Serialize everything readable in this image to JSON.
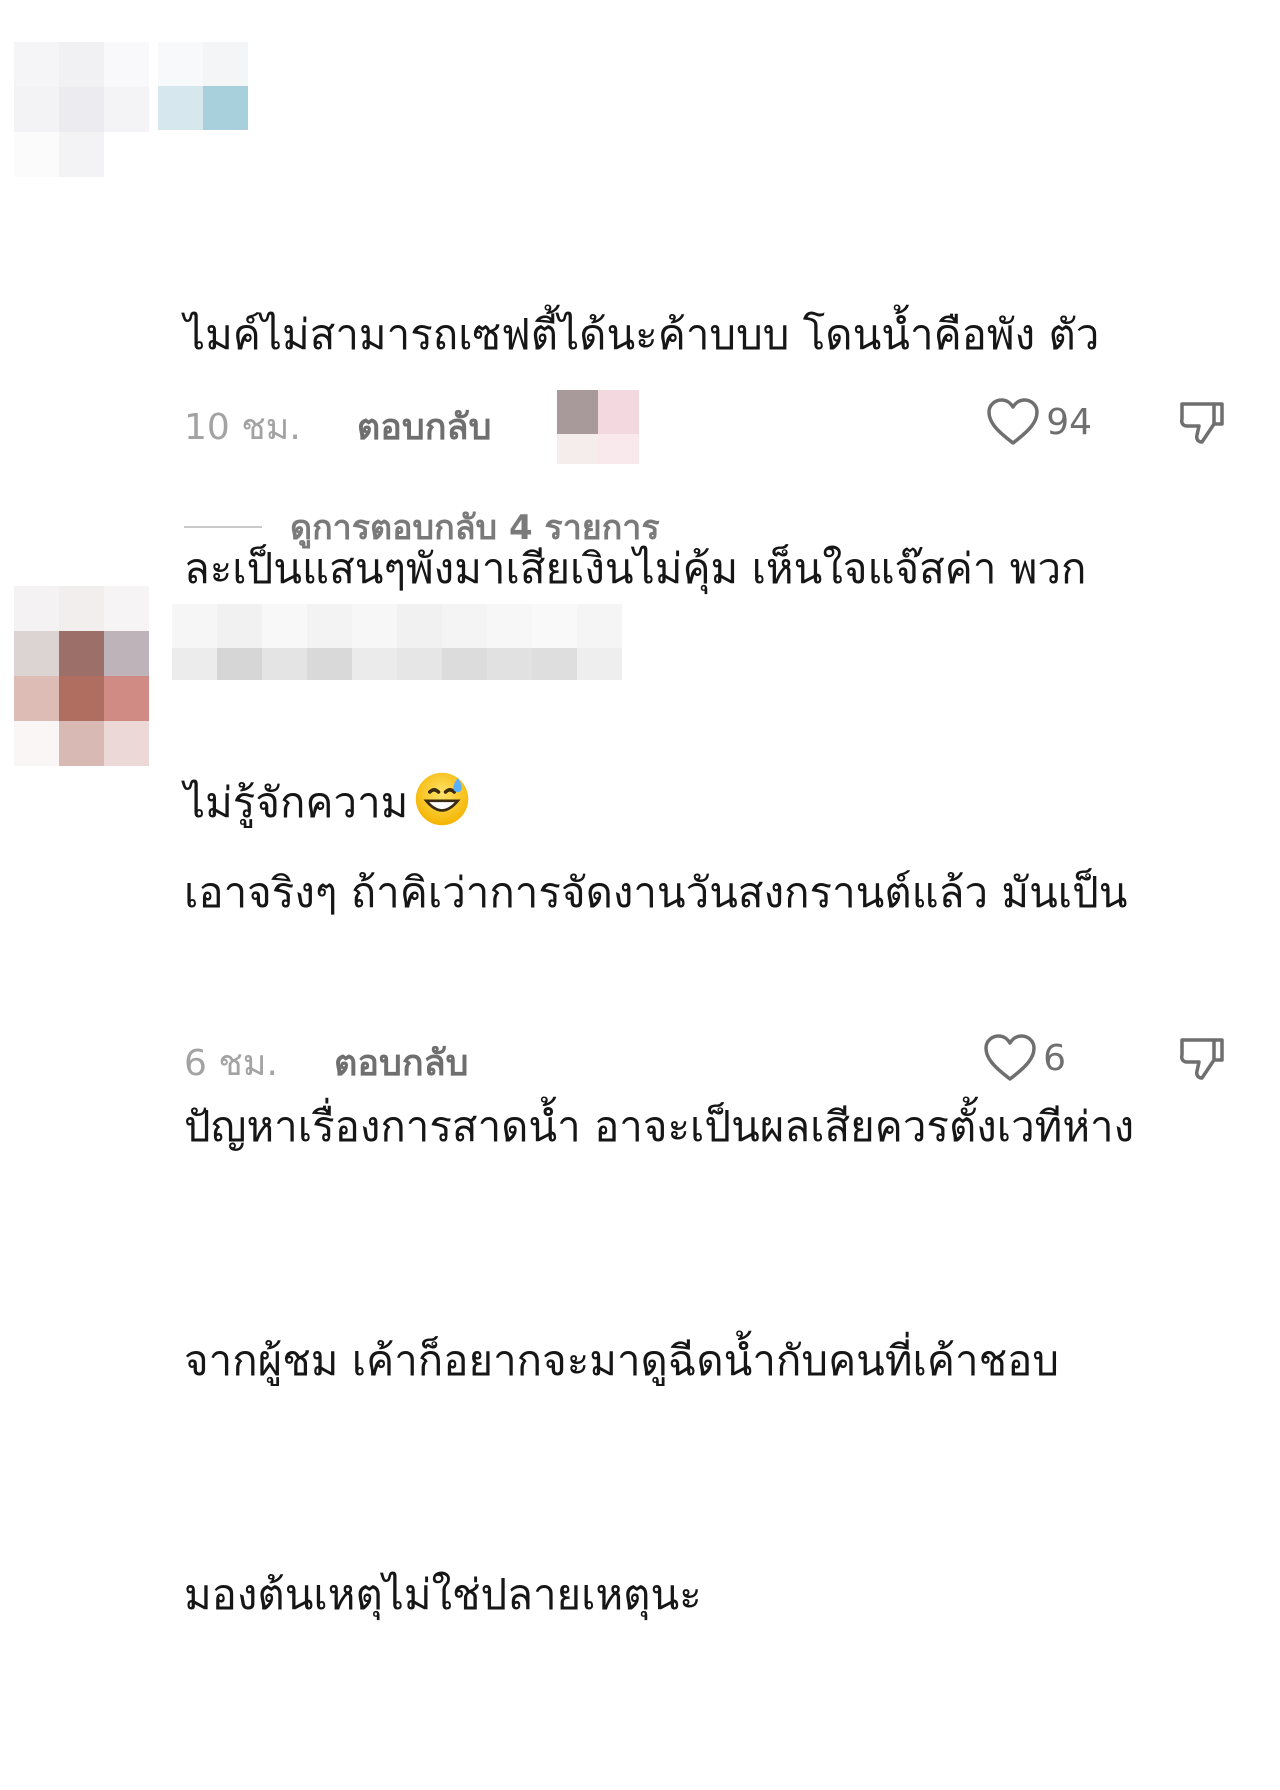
{
  "comments": [
    {
      "text_lines": [
        "ไมค์ไม่สามารถเซฟตี้ได้นะค้าบบบ โดนน้ำคือพัง ตัว",
        "ละเป็นแสนๆพังมาเสียเงินไม่คุ้ม เห็นใจแจ๊สค่า พวก",
        "ไม่รู้จักความ"
      ],
      "emoji": "grinning-face-with-sweat",
      "time": "10 ชม.",
      "reply_label": "ตอบกลับ",
      "likes": "94",
      "view_replies": "ดูการตอบกลับ 4 รายการ"
    },
    {
      "text_lines": [
        "เอาจริงๆ ถ้าคิเว่าการจัดงานวันสงกรานต์แล้ว มันเป็น",
        "ปัญหาเรื่องการสาดน้ำ อาจะเป็นผลเสียควรตั้งเวทีห่าง",
        "จากผู้ชม เค้าก็อยากจะมาดูฉีดน้ำกับคนที่เค้าชอบ",
        "มองต้นเหตุไม่ใช่ปลายเหตุนะ"
      ],
      "time": "6 ชม.",
      "reply_label": "ตอบกลับ",
      "likes": "6"
    }
  ],
  "colors": {
    "text": "#161616",
    "muted": "#a3a3a3",
    "secondary": "#6f6f6f"
  }
}
